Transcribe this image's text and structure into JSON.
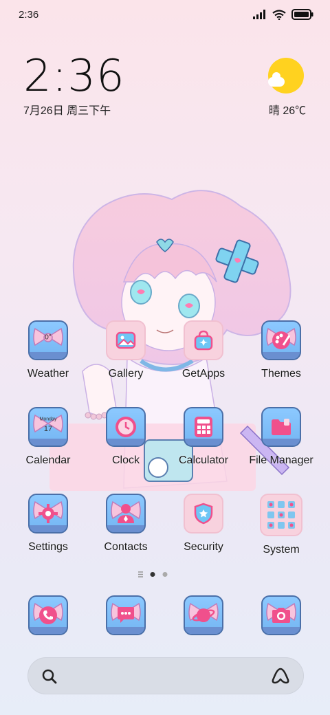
{
  "status_bar": {
    "time": "2:36"
  },
  "clock_widget": {
    "time": "2:36",
    "date": "7月26日 周三下午"
  },
  "weather_widget": {
    "condition_temp": "晴 26℃"
  },
  "apps": [
    {
      "label": "Weather",
      "icon": "weather-bow-icon",
      "badge": "0°"
    },
    {
      "label": "Gallery",
      "icon": "gallery-icon"
    },
    {
      "label": "GetApps",
      "icon": "getapps-icon"
    },
    {
      "label": "Themes",
      "icon": "themes-icon"
    },
    {
      "label": "Calendar",
      "icon": "calendar-icon",
      "cal_day": "Monday",
      "cal_num": "17"
    },
    {
      "label": "Clock",
      "icon": "clock-icon"
    },
    {
      "label": "Calculator",
      "icon": "calculator-icon"
    },
    {
      "label": "File Manager",
      "icon": "folder-icon"
    },
    {
      "label": "Settings",
      "icon": "gear-icon"
    },
    {
      "label": "Contacts",
      "icon": "person-icon"
    },
    {
      "label": "Security",
      "icon": "shield-icon"
    },
    {
      "label": "System",
      "icon": "folder-grid-icon"
    }
  ],
  "dock": [
    {
      "icon": "phone-icon"
    },
    {
      "icon": "message-icon"
    },
    {
      "icon": "browser-planet-icon"
    },
    {
      "icon": "camera-icon"
    }
  ],
  "search": {
    "left_icon": "search-icon",
    "right_icon": "assistant-icon"
  },
  "colors": {
    "bow_blue": "#8cc9ff",
    "bow_pink": "#f7c4dd",
    "accent_pink": "#f0508c",
    "sun": "#ffd21f"
  }
}
